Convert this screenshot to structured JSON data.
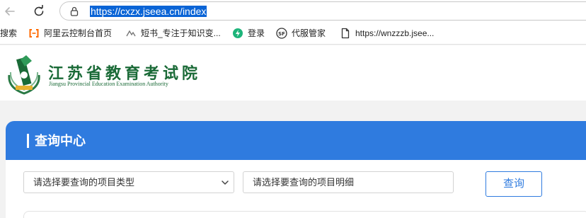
{
  "browser": {
    "url_prefix": "https://cxzx.jseea.cn/index",
    "icons": {
      "back": "arrow-left-icon",
      "reload": "reload-icon",
      "site_info": "lock-icon"
    }
  },
  "bookmarks": [
    {
      "label": "搜索",
      "icon": ""
    },
    {
      "label": "阿里云控制台首页",
      "icon": "aliyun-icon"
    },
    {
      "label": "短书_专注于知识变...",
      "icon": "duanshu-icon"
    },
    {
      "label": "登录",
      "icon": "green-leaf-icon"
    },
    {
      "label": "代服管家",
      "icon": "sf-icon"
    },
    {
      "label": "https://wnzzzb.jsee...",
      "icon": "page-icon"
    }
  ],
  "site": {
    "name_cn": "江苏省教育考试院",
    "name_en": "Jiangsu Provincial Education Examination Authority",
    "brand_color": "#1a6a37"
  },
  "query": {
    "title": "查询中心",
    "accent": "#2f7bdf",
    "type_select": "请选择要查询的项目类型",
    "detail_select": "请选择要查询的项目明细",
    "submit_label": "查询"
  }
}
